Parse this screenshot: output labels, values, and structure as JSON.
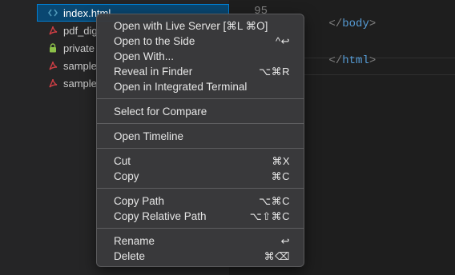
{
  "explorer": {
    "files": [
      {
        "name": "index.html",
        "icon": "html-code-icon",
        "icon_glyph": "<>",
        "color": "#519aba",
        "selected": true
      },
      {
        "name": "pdf_digi",
        "icon": "pdf-icon",
        "icon_glyph": "✗",
        "color": "#cc3e44",
        "selected": false
      },
      {
        "name": "private",
        "icon": "lock-icon",
        "icon_glyph": "🔒",
        "color": "#8dc149",
        "selected": false
      },
      {
        "name": "sample",
        "icon": "pdf-icon",
        "icon_glyph": "✗",
        "color": "#cc3e44",
        "selected": false
      },
      {
        "name": "sample",
        "icon": "pdf-icon",
        "icon_glyph": "✗",
        "color": "#cc3e44",
        "selected": false
      }
    ]
  },
  "editor": {
    "line_numbers": [
      "95"
    ],
    "lines": [
      {
        "open": "</",
        "tag": "body",
        "close": ">"
      },
      {
        "open": "</",
        "tag": "html",
        "close": ">"
      }
    ]
  },
  "context_menu": {
    "groups": [
      [
        {
          "label": "Open with Live Server [⌘L ⌘O]",
          "shortcut": ""
        },
        {
          "label": "Open to the Side",
          "shortcut": "^↩"
        },
        {
          "label": "Open With...",
          "shortcut": ""
        },
        {
          "label": "Reveal in Finder",
          "shortcut": "⌥⌘R"
        },
        {
          "label": "Open in Integrated Terminal",
          "shortcut": ""
        }
      ],
      [
        {
          "label": "Select for Compare",
          "shortcut": ""
        }
      ],
      [
        {
          "label": "Open Timeline",
          "shortcut": ""
        }
      ],
      [
        {
          "label": "Cut",
          "shortcut": "⌘X"
        },
        {
          "label": "Copy",
          "shortcut": "⌘C"
        }
      ],
      [
        {
          "label": "Copy Path",
          "shortcut": "⌥⌘C"
        },
        {
          "label": "Copy Relative Path",
          "shortcut": "⌥⇧⌘C"
        }
      ],
      [
        {
          "label": "Rename",
          "shortcut": "↩"
        },
        {
          "label": "Delete",
          "shortcut": "⌘⌫"
        }
      ]
    ]
  },
  "colors": {
    "sidebar_bg": "#252526",
    "editor_bg": "#1e1e1e",
    "selection_bg": "#094771",
    "menu_bg": "#3a3a3c",
    "tag_color": "#569cd6"
  }
}
